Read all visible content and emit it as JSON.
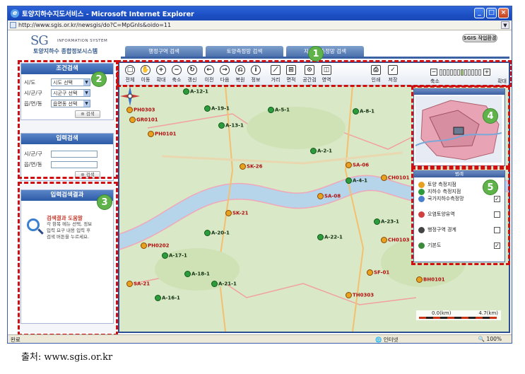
{
  "window": {
    "title": "토양지하수지도서비스 - Microsoft Internet Explorer",
    "url": "http://www.sgis.or.kr/newsgis/do?C=MpGnIs&oido=11",
    "controls": [
      "_",
      "□",
      "×"
    ]
  },
  "header": {
    "logo_sg": "SG",
    "logo_info": "INFORMATION SYSTEM",
    "logo_sub": "토양지하수 종합정보시스템",
    "badge": "SGIS 작업환경",
    "tabs": [
      "행정구역 검색",
      "토양측정망 검색",
      "지하수 측정망 검색"
    ]
  },
  "condition_search": {
    "title": "조건검색",
    "rows": [
      {
        "label": "시/도",
        "value": "시도 선택"
      },
      {
        "label": "시/군/구",
        "value": "시군구 선택"
      },
      {
        "label": "읍/면/동",
        "value": "읍면동 선택"
      }
    ],
    "button": "검색"
  },
  "input_search": {
    "title": "입력검색",
    "rows": [
      {
        "label": "시/군/구"
      },
      {
        "label": "읍/면/동"
      }
    ],
    "button": "검색"
  },
  "input_result": {
    "title": "입력검색결과",
    "heading": "검색결과 도움말",
    "text": "각 항목 메뉴 선택, 정보입력 요구 내용 입력 후 검색 버튼을 누르세요."
  },
  "toolbar": {
    "tools": [
      {
        "label": "전체",
        "icon": "globe-icon",
        "glyph": "□"
      },
      {
        "label": "이동",
        "icon": "hand-icon",
        "glyph": "✋"
      },
      {
        "label": "확대",
        "icon": "zoom-in-icon",
        "glyph": "+"
      },
      {
        "label": "축소",
        "icon": "zoom-out-icon",
        "glyph": "−"
      },
      {
        "label": "갱신",
        "icon": "refresh-icon",
        "glyph": "↻"
      },
      {
        "label": "이전",
        "icon": "back-icon",
        "glyph": "←"
      },
      {
        "label": "다음",
        "icon": "forward-icon",
        "glyph": "→"
      },
      {
        "label": "복원",
        "icon": "restore-icon",
        "glyph": "⎌"
      },
      {
        "label": "정보",
        "icon": "info-icon",
        "glyph": "i"
      },
      {
        "label": "거리",
        "icon": "distance-icon",
        "glyph": "⟋"
      },
      {
        "label": "면적",
        "icon": "area-icon",
        "glyph": "⊞"
      },
      {
        "label": "공간검색",
        "icon": "spatial-search-icon",
        "glyph": "⊙"
      },
      {
        "label": "영역",
        "icon": "region-icon",
        "glyph": "◫"
      },
      {
        "label": "인쇄",
        "icon": "print-icon",
        "glyph": "⎙"
      },
      {
        "label": "저장",
        "icon": "save-icon",
        "glyph": "✓"
      }
    ],
    "zoom_out_label": "축소",
    "zoom_in_label": "확대",
    "zoom_level_index": 6,
    "zoom_level_count": 12
  },
  "map": {
    "labels": [
      {
        "text": "A-12-1",
        "kind": "green"
      },
      {
        "text": "A-19-1",
        "kind": "green"
      },
      {
        "text": "A-5-1",
        "kind": "green"
      },
      {
        "text": "A-8-1",
        "kind": "green"
      },
      {
        "text": "A-13-1",
        "kind": "green"
      },
      {
        "text": "A-2-1",
        "kind": "green"
      },
      {
        "text": "A-4-1",
        "kind": "green"
      },
      {
        "text": "A-23-1",
        "kind": "green"
      },
      {
        "text": "A-22-1",
        "kind": "green"
      },
      {
        "text": "A-18-1",
        "kind": "green"
      },
      {
        "text": "A-21-1",
        "kind": "green"
      },
      {
        "text": "A-20-1",
        "kind": "green"
      },
      {
        "text": "A-17-1",
        "kind": "green"
      },
      {
        "text": "A-16-1",
        "kind": "green"
      },
      {
        "text": "PH0303",
        "kind": "red"
      },
      {
        "text": "GR0101",
        "kind": "red"
      },
      {
        "text": "PH0101",
        "kind": "red"
      },
      {
        "text": "PH0202",
        "kind": "red"
      },
      {
        "text": "SA-06",
        "kind": "red"
      },
      {
        "text": "SA-08",
        "kind": "red"
      },
      {
        "text": "SA-21",
        "kind": "red"
      },
      {
        "text": "SK-21",
        "kind": "red"
      },
      {
        "text": "CH0101",
        "kind": "red"
      },
      {
        "text": "CH0103",
        "kind": "red"
      },
      {
        "text": "BH0101",
        "kind": "red"
      },
      {
        "text": "SF-01",
        "kind": "red"
      },
      {
        "text": "TH0303",
        "kind": "red"
      },
      {
        "text": "SK-26",
        "kind": "red"
      }
    ],
    "scale_left": "0.0(km)",
    "scale_right": "4.7(km)"
  },
  "legend": {
    "title": "범례",
    "items": [
      {
        "label": "토양 측정지점",
        "checked": "",
        "color": "#e8a020"
      },
      {
        "label": "지하수 측정지점",
        "checked": "",
        "color": "#2d9a3c"
      },
      {
        "label": "국가지하수측정망",
        "checked": "✓",
        "color": "#4a7fd0"
      },
      {
        "label": "오염토양유역",
        "checked": "",
        "color": "#d04040"
      },
      {
        "label": "행정구역 경계",
        "checked": "",
        "color": "#444444"
      },
      {
        "label": "기본도",
        "checked": "✓",
        "color": "#3c8a3c"
      }
    ]
  },
  "status": {
    "left": "완료",
    "zone": "인터넷",
    "zoom": "100%"
  },
  "annotations": [
    "1",
    "2",
    "3",
    "4",
    "5"
  ],
  "source": "출처: www.sgis.or.kr"
}
